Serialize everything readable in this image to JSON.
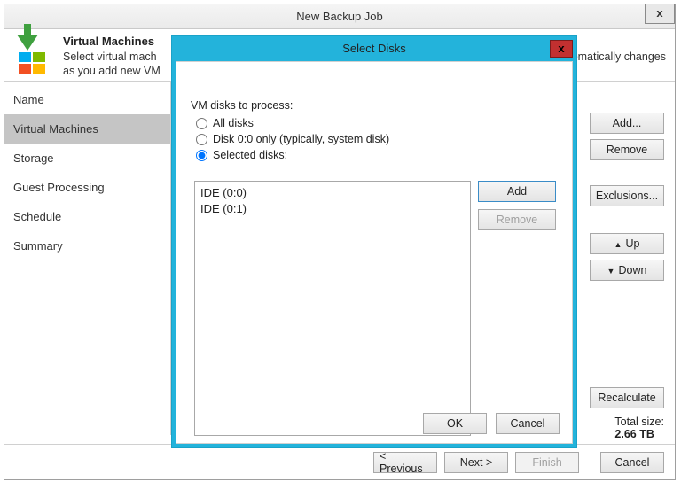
{
  "window": {
    "title": "New Backup Job"
  },
  "header": {
    "title": "Virtual Machines",
    "description_cut": "Select virtual mach\nas you add new VM",
    "description_tail": "omatically changes"
  },
  "sidebar": {
    "items": [
      {
        "label": "Name"
      },
      {
        "label": "Virtual Machines",
        "selected": true
      },
      {
        "label": "Storage"
      },
      {
        "label": "Guest Processing"
      },
      {
        "label": "Schedule"
      },
      {
        "label": "Summary"
      }
    ]
  },
  "main": {
    "buttons": {
      "add": "Add...",
      "remove": "Remove",
      "exclusions": "Exclusions...",
      "up": "Up",
      "down": "Down",
      "recalculate": "Recalculate"
    },
    "total_label": "Total size:",
    "total_value": "2.66 TB"
  },
  "wizard": {
    "previous": "< Previous",
    "next": "Next >",
    "finish": "Finish",
    "cancel": "Cancel"
  },
  "dialog": {
    "title": "Select Disks",
    "section": "VM disks to process:",
    "options": {
      "all": "All disks",
      "disk00": "Disk 0:0 only (typically, system disk)",
      "selected": "Selected disks:"
    },
    "selected_value": "selected",
    "disks": [
      "IDE (0:0)",
      "IDE (0:1)"
    ],
    "buttons": {
      "add": "Add",
      "remove": "Remove",
      "ok": "OK",
      "cancel": "Cancel"
    }
  }
}
